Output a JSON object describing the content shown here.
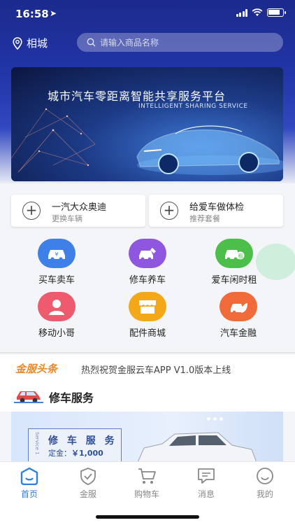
{
  "status": {
    "time": "16:58",
    "location_icon": "location-arrow-icon",
    "battery_fraction": 0.85
  },
  "header": {
    "city": "相城",
    "search_placeholder": "请输入商品名称"
  },
  "banner": {
    "title": "城市汽车零距离智能共享服务平台",
    "subtitle": "INTELLIGENT SHARING SERVICE"
  },
  "quick_cards": [
    {
      "title": "一汽大众奥迪",
      "subtitle": "更换车辆"
    },
    {
      "title": "给爱车做体检",
      "subtitle": "推荐套餐"
    }
  ],
  "grid": [
    {
      "label": "买车卖车",
      "icon": "car-buy-sell-icon",
      "color": "#3f7fe8"
    },
    {
      "label": "修车养车",
      "icon": "wrench-car-icon",
      "color": "#8f56e0"
    },
    {
      "label": "爱车闲时租",
      "icon": "car-rent-icon",
      "color": "#4cbf4a"
    },
    {
      "label": "移动小哥",
      "icon": "mechanic-icon",
      "color": "#ee5a6e"
    },
    {
      "label": "配件商城",
      "icon": "store-icon",
      "color": "#f3a81a"
    },
    {
      "label": "汽车金融",
      "icon": "finance-leaf-icon",
      "color": "#f06a3a"
    }
  ],
  "news": {
    "tag": "金服头条",
    "text": "热烈祝贺金服云车APP V1.0版本上线"
  },
  "service": {
    "section_title": "修车服务",
    "card_title": "修 车 服 务",
    "card_vertical": "Service 1",
    "price_label": "定金：",
    "price_value": "￥1,000"
  },
  "tabs": [
    {
      "label": "首页",
      "icon": "home-icon",
      "active": true
    },
    {
      "label": "金服",
      "icon": "shield-check-icon",
      "active": false
    },
    {
      "label": "购物车",
      "icon": "cart-icon",
      "active": false
    },
    {
      "label": "消息",
      "icon": "message-icon",
      "active": false
    },
    {
      "label": "我的",
      "icon": "smile-icon",
      "active": false
    }
  ],
  "colors": {
    "accent": "#2f7fe0",
    "header_blue": "#2235a8",
    "news_orange": "#e8892b"
  }
}
